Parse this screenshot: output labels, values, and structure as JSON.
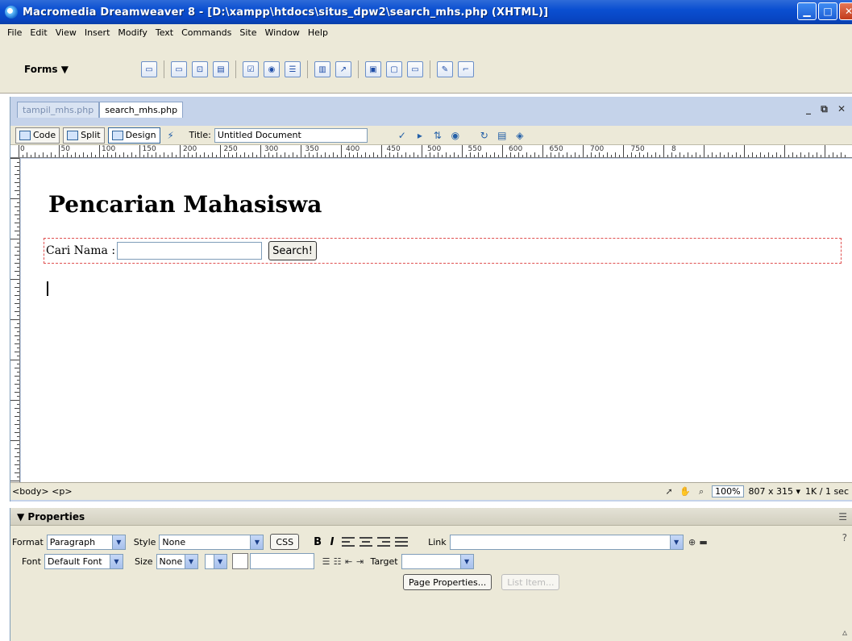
{
  "window": {
    "title": "Macromedia Dreamweaver 8 - [D:\\xampp\\htdocs\\situs_dpw2\\search_mhs.php (XHTML)]"
  },
  "menu": [
    "File",
    "Edit",
    "View",
    "Insert",
    "Modify",
    "Text",
    "Commands",
    "Site",
    "Window",
    "Help"
  ],
  "insert_bar": {
    "category": "Forms ▼"
  },
  "doc": {
    "tabs": [
      "tampil_mhs.php",
      "search_mhs.php"
    ],
    "view_buttons": [
      "Code",
      "Split",
      "Design"
    ],
    "title_label": "Title:",
    "title_value": "Untitled Document",
    "ruler_labels": [
      "0",
      "50",
      "100",
      "150",
      "200",
      "250",
      "300",
      "350",
      "400",
      "450",
      "500",
      "550",
      "600",
      "650",
      "700",
      "750",
      "8"
    ]
  },
  "page": {
    "heading": "Pencarian Mahasiswa",
    "form_label": "Cari Nama :",
    "button_label": "Search!"
  },
  "status": {
    "tag_selector": "<body> <p>",
    "zoom": "100%",
    "dimensions": "807 x 315 ▾",
    "size_time": "1K / 1 sec"
  },
  "properties": {
    "title": "▼ Properties",
    "format_label": "Format",
    "format_value": "Paragraph",
    "style_label": "Style",
    "style_value": "None",
    "css_button": "CSS",
    "bold": "B",
    "italic": "I",
    "link_label": "Link",
    "font_label": "Font",
    "font_value": "Default Font",
    "size_label": "Size",
    "size_value": "None",
    "target_label": "Target",
    "page_properties": "Page Properties...",
    "list_item": "List Item..."
  }
}
